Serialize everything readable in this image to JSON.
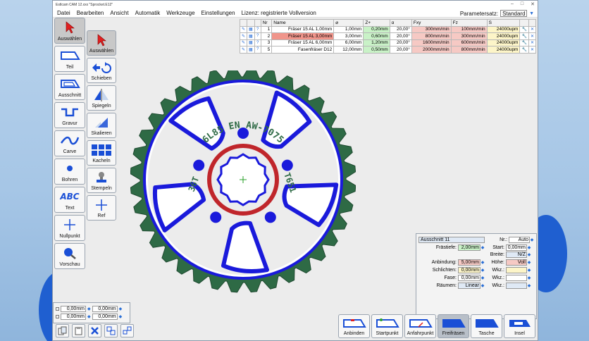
{
  "window": {
    "title": "Estlcam CAM 12.xxx \"Sprocket.E12\"",
    "controls": [
      "–",
      "□",
      "✕"
    ]
  },
  "menu": {
    "items": [
      "Datei",
      "Bearbeiten",
      "Ansicht",
      "Automatik",
      "Werkzeuge",
      "Einstellungen"
    ],
    "license": "Lizenz: registrierte Vollversion",
    "paramset_label": "Parametersatz:",
    "paramset_value": "Standard"
  },
  "tools_primary": [
    {
      "label": "Auswählen",
      "icon": "cursor-icon",
      "active": true
    },
    {
      "label": "Teil",
      "icon": "part-icon"
    },
    {
      "label": "Ausschnitt",
      "icon": "cutout-icon"
    },
    {
      "label": "Gravur",
      "icon": "engrave-icon"
    },
    {
      "label": "Carve",
      "icon": "carve-icon"
    },
    {
      "label": "Bohren",
      "icon": "drill-icon"
    },
    {
      "label": "Text",
      "icon": "text-icon",
      "glyph": "ABC"
    },
    {
      "label": "Nullpunkt",
      "icon": "origin-icon"
    },
    {
      "label": "Vorschau",
      "icon": "preview-icon"
    }
  ],
  "tools_secondary": [
    {
      "label": "Auswählen",
      "icon": "cursor-icon",
      "active": true
    },
    {
      "label": "Schieben",
      "icon": "move-icon"
    },
    {
      "label": "Spiegeln",
      "icon": "mirror-icon"
    },
    {
      "label": "Skalieren",
      "icon": "scale-icon"
    },
    {
      "label": "Kacheln",
      "icon": "tile-icon"
    },
    {
      "label": "Stempeln",
      "icon": "stamp-icon"
    },
    {
      "label": "Ref",
      "icon": "reference-icon"
    }
  ],
  "tool_table": {
    "headers": [
      "Nr",
      "Name",
      "⌀",
      "Z+",
      "α",
      "Fxy",
      "Fz",
      "S"
    ],
    "rows": [
      {
        "nr": "1",
        "name": "Fräser 15 AL 1,00mm",
        "d": "1,00mm",
        "z": "0,20mm",
        "a": "20,00°",
        "fxy": "300mm/min",
        "fz": "100mm/min",
        "s": "24000upm",
        "selected": false
      },
      {
        "nr": "2",
        "name": "Fräser 15 AL 3,00mm",
        "d": "3,00mm",
        "z": "0,60mm",
        "a": "20,00°",
        "fxy": "800mm/min",
        "fz": "300mm/min",
        "s": "24000upm",
        "selected": true
      },
      {
        "nr": "3",
        "name": "Fräser 15 AL 6,00mm",
        "d": "6,00mm",
        "z": "1,20mm",
        "a": "20,00°",
        "fxy": "1600mm/min",
        "fz": "600mm/min",
        "s": "24000upm",
        "selected": false
      },
      {
        "nr": "5",
        "name": "Fasenfräser D12",
        "d": "12,00mm",
        "z": "0,50mm",
        "a": "20,00°",
        "fxy": "2000mm/min",
        "fz": "800mm/min",
        "s": "24000upm",
        "selected": false
      }
    ]
  },
  "sprocket": {
    "engraving_top": "6L85 EN AW-7075",
    "engraving_left": "36T",
    "engraving_right": "T651",
    "colors": {
      "outer": "#2e6a45",
      "pocket": "#1a1adb",
      "hub": "#c0262b",
      "origin": "#2aa02a"
    }
  },
  "properties": {
    "name": "Ausschnitt 11",
    "nr_label": "Nr.:",
    "nr_value": "Auto",
    "fields": [
      {
        "label": "Frästiefe:",
        "value": "2,00mm",
        "color": "g"
      },
      {
        "label": "",
        "value": "",
        "color": ""
      },
      {
        "label": "Anbindung:",
        "value": "5,00mm",
        "color": "r"
      },
      {
        "label": "Schlichten:",
        "value": "0,00mm",
        "color": "y"
      },
      {
        "label": "Fase:",
        "value": "0,00mm",
        "color": ""
      },
      {
        "label": "Räumen:",
        "value": "Linear",
        "color": "lb"
      }
    ],
    "right_fields": [
      {
        "label": "Start:",
        "value": "0,00mm",
        "color": ""
      },
      {
        "label": "Breite:",
        "value": "N/Z",
        "color": "lb"
      },
      {
        "label": "Höhe:",
        "value": "Voll",
        "color": "r"
      },
      {
        "label": "Wkz.:",
        "value": "",
        "color": "y"
      },
      {
        "label": "Wkz.:",
        "value": "",
        "color": ""
      },
      {
        "label": "Wkz.:",
        "value": "",
        "color": "lb"
      }
    ]
  },
  "coords": {
    "x1": "0,00mm",
    "x2": "0,00mm",
    "y1": "0,00mm",
    "y2": "0,00mm"
  },
  "action_buttons": [
    {
      "label": "Anbinden",
      "icon": "bridge-icon"
    },
    {
      "label": "Startpunkt",
      "icon": "start-point-icon"
    },
    {
      "label": "Anfahrpunkt",
      "icon": "approach-point-icon"
    },
    {
      "label": "Freifräsen",
      "icon": "clear-icon",
      "dark": true
    },
    {
      "label": "Tasche",
      "icon": "pocket-icon"
    },
    {
      "label": "Insel",
      "icon": "island-icon"
    }
  ]
}
